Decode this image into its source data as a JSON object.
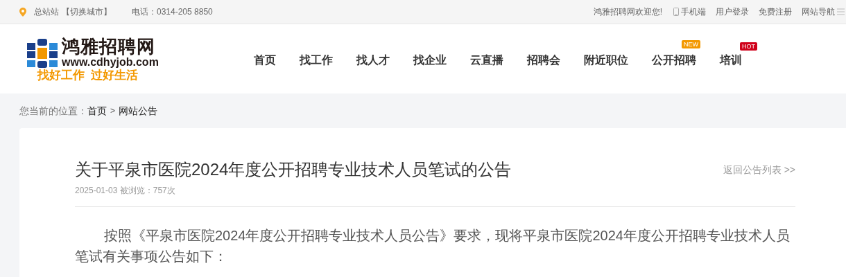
{
  "top_bar": {
    "city": "总站站",
    "switch_city": "【切换城市】",
    "phone": "电话：0314-205 8850",
    "welcome": "鸿雅招聘网欢迎您!",
    "links": [
      {
        "label": "手机端",
        "kind": "mobile"
      },
      {
        "label": "用户登录",
        "kind": "plain"
      },
      {
        "label": "免费注册",
        "kind": "plain"
      },
      {
        "label": "网站导航",
        "kind": "menu"
      }
    ]
  },
  "logo": {
    "name": "鸿雅招聘网",
    "url": "www.cdhyjob.com",
    "slogan": "找好工作  过好生活"
  },
  "nav": [
    {
      "label": "首页"
    },
    {
      "label": "找工作"
    },
    {
      "label": "找人才"
    },
    {
      "label": "找企业"
    },
    {
      "label": "云直播"
    },
    {
      "label": "招聘会"
    },
    {
      "label": "附近职位"
    },
    {
      "label": "公开招聘",
      "badge": {
        "text": "NEW",
        "kind": "new"
      }
    },
    {
      "label": "培训",
      "badge": {
        "text": "HOT",
        "kind": "hot"
      }
    }
  ],
  "breadcrumb": {
    "prefix": "您当前的位置：",
    "items": [
      "首页",
      "网站公告"
    ],
    "separator": ">"
  },
  "article": {
    "title": "关于平泉市医院2024年度公开招聘专业技术人员笔试的公告",
    "back_link": "返回公告列表 >>",
    "meta": "2025-01-03 被浏览：757次",
    "paragraphs": [
      "按照《平泉市医院2024年度公开招聘专业技术人员公告》要求，现将平泉市医院2024年度公开招聘专业技术人员笔试有关事项公告如下："
    ]
  }
}
